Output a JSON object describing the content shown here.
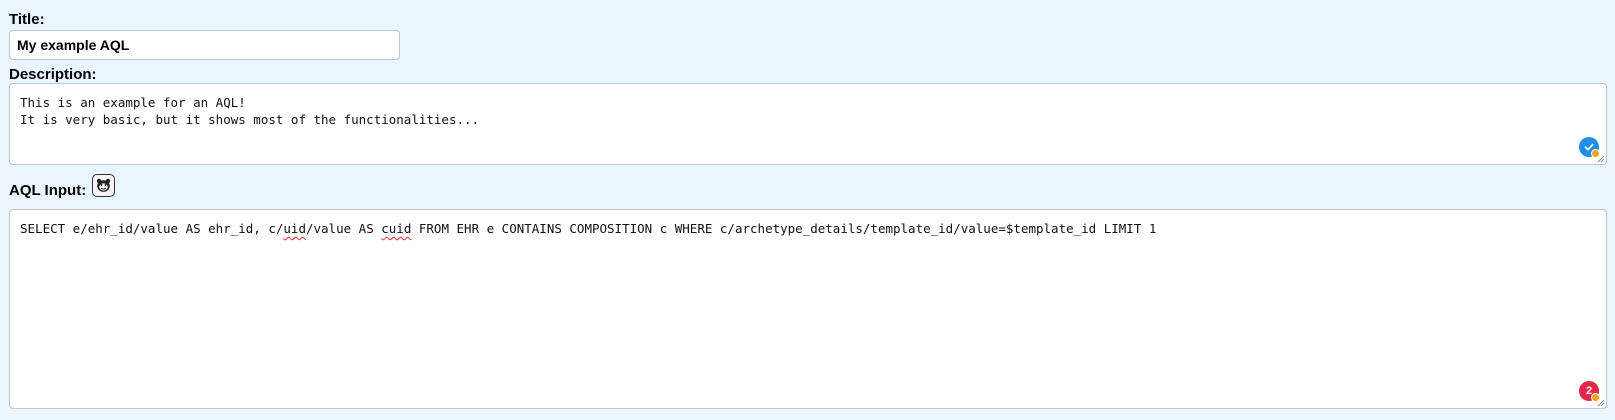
{
  "title": {
    "label": "Title:",
    "value": "My example AQL"
  },
  "description": {
    "label": "Description:",
    "value": "This is an example for an AQL!\nIt is very basic, but it shows most of the functionalities...",
    "grammar_badge": {
      "icon": "checkmark-icon",
      "color": "#1f8fe5"
    }
  },
  "aql": {
    "label": "AQL Input:",
    "helper_icon": "mascot-icon",
    "query_parts": [
      "SELECT e/ehr_id/value AS ehr_id, c/",
      "uid",
      "/value AS ",
      "cuid",
      " FROM EHR e CONTAINS COMPOSITION c WHERE c/archetype_details/template_id/value=$template_id LIMIT 1"
    ],
    "grammar_badge": {
      "count": "2",
      "color": "#e5264a"
    }
  },
  "colors": {
    "background": "#eaf6fd",
    "border": "#bfc5cc",
    "spell_error": "#e0353a"
  }
}
